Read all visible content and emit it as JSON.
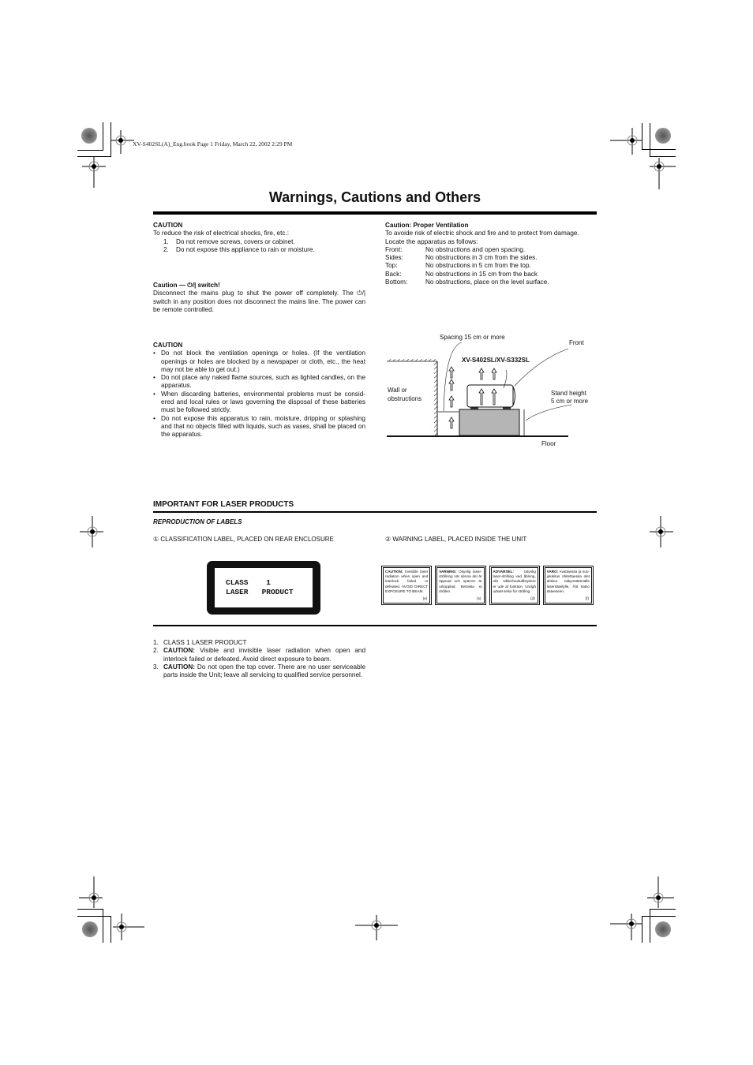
{
  "header": {
    "file_info": "XV-S402SL(A)_Eng.book  Page 1  Friday, March 22, 2002  2:29 PM"
  },
  "page": {
    "title": "Warnings, Cautions and Others"
  },
  "left": {
    "caution1": {
      "heading": "CAUTION",
      "intro": "To reduce the risk of electrical shocks, fire, etc.:",
      "items": [
        {
          "n": "1.",
          "text": "Do not remove screws, covers or cabinet."
        },
        {
          "n": "2.",
          "text": "Do not expose this appliance to rain or moisture."
        }
      ]
    },
    "caution_switch": {
      "heading_prefix": "Caution — ",
      "switch_symbol": "⏻/|",
      "heading_suffix": " switch!",
      "body_part1": "Disconnect  the mains plug  to shut the power off completely. The ",
      "body_symbol": "⏻/|",
      "body_part2": " switch in any position does not disconnect the mains line. The power can be remote controlled."
    },
    "caution2": {
      "heading": "CAUTION",
      "bullet_glyph": "•",
      "items": [
        "Do not block the ventilation openings or holes. (If the ventilation openings or holes are blocked by a newspaper or cloth, etc., the heat may not be able to get out.)",
        "Do not place any naked flame sources, such as lighted candles, on the apparatus.",
        "When discarding batteries, environmental problems must be consid-ered and local rules or laws governing the disposal of these batteries must be followed strictly.",
        "Do not expose this apparatus to rain, moisture, dripping or splashing and that no objects filled with liquids, such as vases, shall be placed on the apparatus."
      ]
    }
  },
  "right": {
    "ventilation": {
      "heading": "Caution: Proper Ventilation",
      "intro": "To avoide risk of electric shock and fire and to protect from damage.",
      "locate": "Locate the apparatus as follows:",
      "rows": [
        {
          "label": "Front:",
          "text": "No obstructions and open spacing."
        },
        {
          "label": "Sides:",
          "text": "No obstructions in 3 cm from the sides."
        },
        {
          "label": "Top:",
          "text": "No obstructions in 5 cm from the top."
        },
        {
          "label": "Back:",
          "text": "No obstructions in 15 cm from the back"
        },
        {
          "label": "Bottom:",
          "text": "No obstructions, place on the level surface."
        }
      ]
    },
    "diagram": {
      "spacing_label": "Spacing 15 cm or more",
      "front_label": "Front",
      "model_label": "XV-S402SL/XV-S332SL",
      "wall_label_1": "Wall or",
      "wall_label_2": "obstructions",
      "stand_label_1": "Stand height",
      "stand_label_2": "5 cm or more",
      "floor_label": "Floor"
    }
  },
  "laser": {
    "heading": "IMPORTANT FOR LASER PRODUCTS",
    "subheading": "REPRODUCTION OF LABELS",
    "label1_caption": "① CLASSIFICATION LABEL, PLACED ON REAR ENCLOSURE",
    "label2_caption": "② WARNING LABEL, PLACED INSIDE THE UNIT",
    "class_label_line1": "CLASS    1",
    "class_label_line2": "LASER   PRODUCT",
    "warning_labels": [
      {
        "lead": "CAUTION:",
        "text": " Invisible laser radiation when open and interlock failed or defeated. AVOID DIRECT EXPOSURE TO BEAM.",
        "code": "(e)"
      },
      {
        "lead": "VARNING:",
        "text": " Osynlig laser-strålning när denna del är öppnad och spärren är urkopplad. Betrakta ej strålen.",
        "code": "(s)"
      },
      {
        "lead": "ADVARSEL:",
        "text": " Usynlig laser-stråling ved åbning, når sikkerhedsafbrydere er ude af funktion. Undgå udsæt-telse for stråling.",
        "code": "(d)"
      },
      {
        "lead": "VARO:",
        "text": " Avattaessa ja suo-jalukitus ohitettaessa olet alttiina näkymättömälle lasersäteilylle. Älä katso säteeseen.",
        "code": "(f)"
      }
    ],
    "notes": [
      {
        "n": "1.",
        "lead": "",
        "text": "CLASS 1 LASER PRODUCT"
      },
      {
        "n": "2.",
        "lead": "CAUTION:",
        "text": " Visible and invisible laser radiation when open and interlock failed or defeated. Avoid direct exposure to beam."
      },
      {
        "n": "3.",
        "lead": "CAUTION:",
        "text": " Do not open the top cover. There are no user serviceable parts inside the Unit; leave all servicing to qualified service personnel."
      }
    ]
  }
}
